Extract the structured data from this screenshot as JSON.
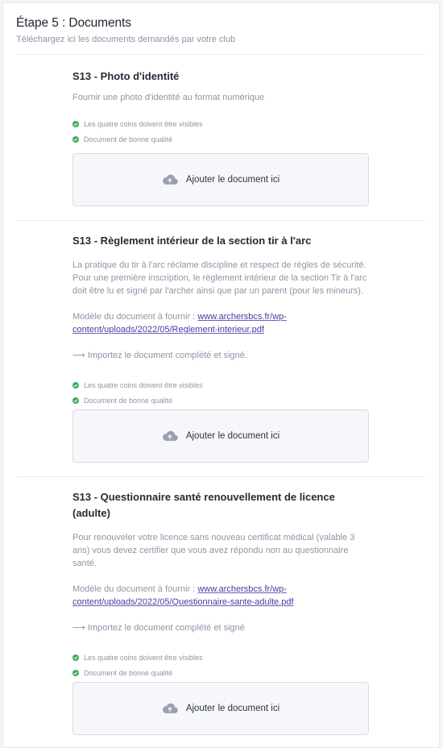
{
  "step": {
    "title": "Étape 5 : Documents",
    "subtitle": "Téléchargez ici les documents demandés par votre club"
  },
  "documents": [
    {
      "title": "S13 - Photo d'identité",
      "description": [
        "Fournir une photo d'identité au format numérique"
      ],
      "checks": [
        "Les quatre coins doivent être visibles",
        "Document de bonne qualité"
      ],
      "upload_label": "Ajouter le document ici"
    },
    {
      "title": "S13 - Règlement intérieur de la section tir à l'arc",
      "description": [
        "La pratique du tir à l'arc réclame discipline et respect de règles de sécurité. Pour une première inscription, le règlement intérieur de la section Tir à l'arc doit être lu et signé par l'archer ainsi que par un parent (pour les mineurs)."
      ],
      "model_label": "Modèle du document à fournir : ",
      "model_link": "www.archersbcs.fr/wp-content/uploads/2022/05/Reglement-interieur.pdf",
      "instruction": "⟶ Importez le document complété et signé.",
      "checks": [
        "Les quatre coins doivent être visibles",
        "Document de bonne qualité"
      ],
      "upload_label": "Ajouter le document ici"
    },
    {
      "title": "S13 - Questionnaire santé renouvellement de licence (adulte)",
      "description": [
        "Pour renouveler votre licence sans nouveau certificat médical (valable 3 ans) vous devez certifier que vous avez répondu non au questionnaire santé."
      ],
      "model_label": "Modèle du document à fournir : ",
      "model_link": "www.archersbcs.fr/wp-content/uploads/2022/05/Questionnaire-sante-adulte.pdf",
      "instruction": "⟶ Importez le document complété et signé",
      "checks": [
        "Les quatre coins doivent être visibles",
        "Document de bonne qualité"
      ],
      "upload_label": "Ajouter le document ici"
    }
  ],
  "colors": {
    "check_green": "#3fae5a",
    "link": "#4a3aa0",
    "upload_bg": "#f6f7fb"
  },
  "icons": {
    "check": "check-circle-icon",
    "upload": "cloud-upload-icon"
  }
}
